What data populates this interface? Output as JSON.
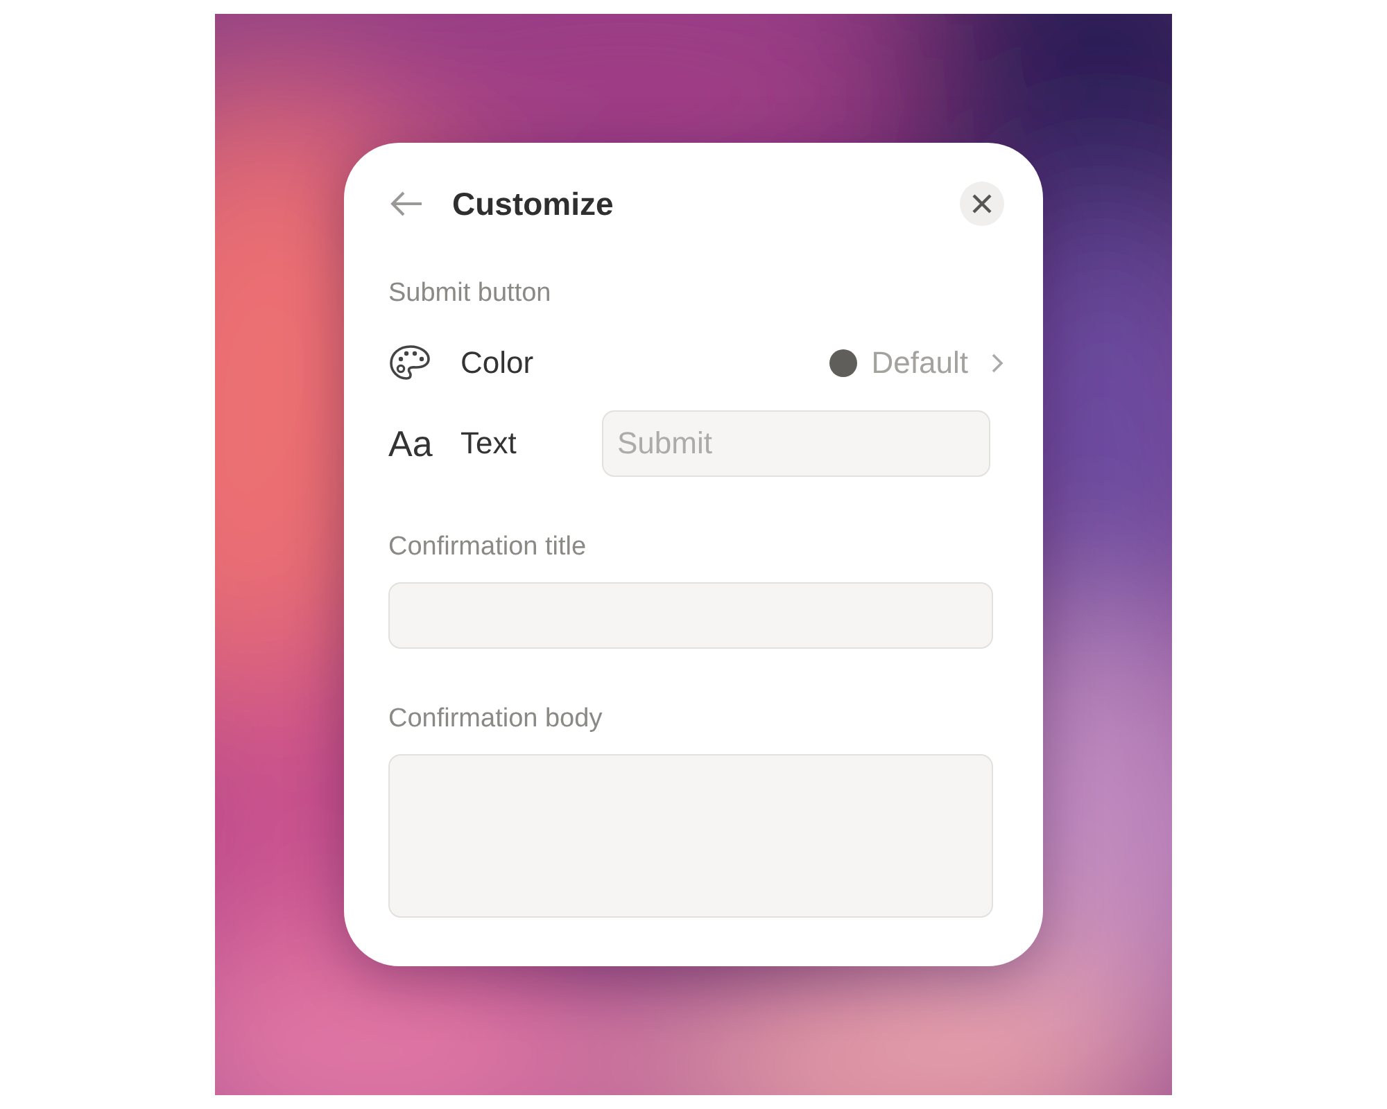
{
  "dialog": {
    "title": "Customize",
    "sections": [
      {
        "label": "Submit button"
      }
    ],
    "color_setting": {
      "label": "Color",
      "value": "Default",
      "color": "#5f5e5a"
    },
    "text_setting": {
      "icon_text": "Aa",
      "label": "Text",
      "placeholder": "Submit"
    },
    "fields": [
      {
        "kind": "input",
        "label": "Confirmation title"
      },
      {
        "kind": "textarea",
        "label": "Confirmation body"
      }
    ]
  }
}
